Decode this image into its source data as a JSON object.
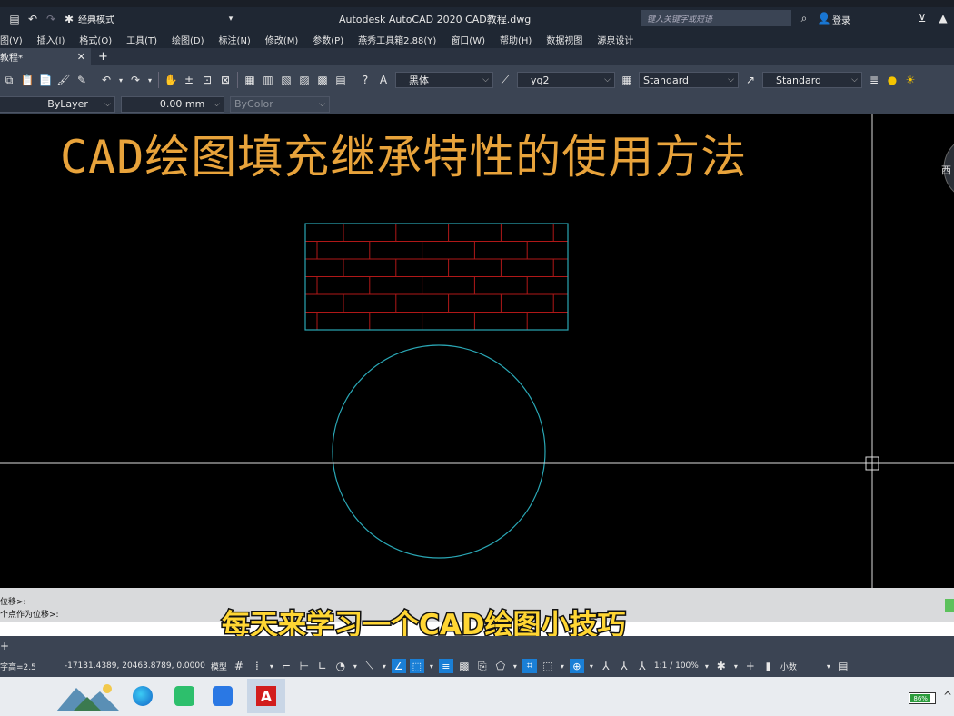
{
  "titlebar": {
    "workspace": "经典模式",
    "app_title": "Autodesk AutoCAD 2020    CAD教程.dwg",
    "search_placeholder": "键入关键字或短语",
    "login": "登录"
  },
  "menubar": {
    "items": [
      "图(V)",
      "插入(I)",
      "格式(O)",
      "工具(T)",
      "绘图(D)",
      "标注(N)",
      "修改(M)",
      "参数(P)",
      "燕秀工具箱2.88(Y)",
      "窗口(W)",
      "帮助(H)",
      "数据视图",
      "源泉设计"
    ]
  },
  "tabbar": {
    "tab_label": "教程*",
    "close_symbol": "✕",
    "add_symbol": "+"
  },
  "toolbar1": {
    "text_style_font": "黑体",
    "dim_style": "yq2",
    "table_style": "Standard",
    "multileader_style": "Standard"
  },
  "toolbar2": {
    "linetype": "ByLayer",
    "lineweight": "0.00 mm",
    "plotstyle": "ByColor"
  },
  "canvas": {
    "headline": "CAD绘图填充继承特性的使用方法",
    "viewcube_label": "西"
  },
  "command": {
    "line1": "位移>:",
    "line2": "个点作为位移>:"
  },
  "subtitle": "每天来学习一个CAD绘图小技巧",
  "statusbar": {
    "left_text": "字高=2.5",
    "coordinates": "-17131.4389, 20463.8789, 0.0000",
    "model": "模型",
    "scale": "1:1 / 100%",
    "units": "小数"
  },
  "taskbar": {
    "battery": "86%"
  },
  "colors": {
    "headline": "#e8a33b",
    "subtitle": "#ffd633",
    "hatch_brick": "#b01818",
    "boundary": "#2aa7b5"
  }
}
